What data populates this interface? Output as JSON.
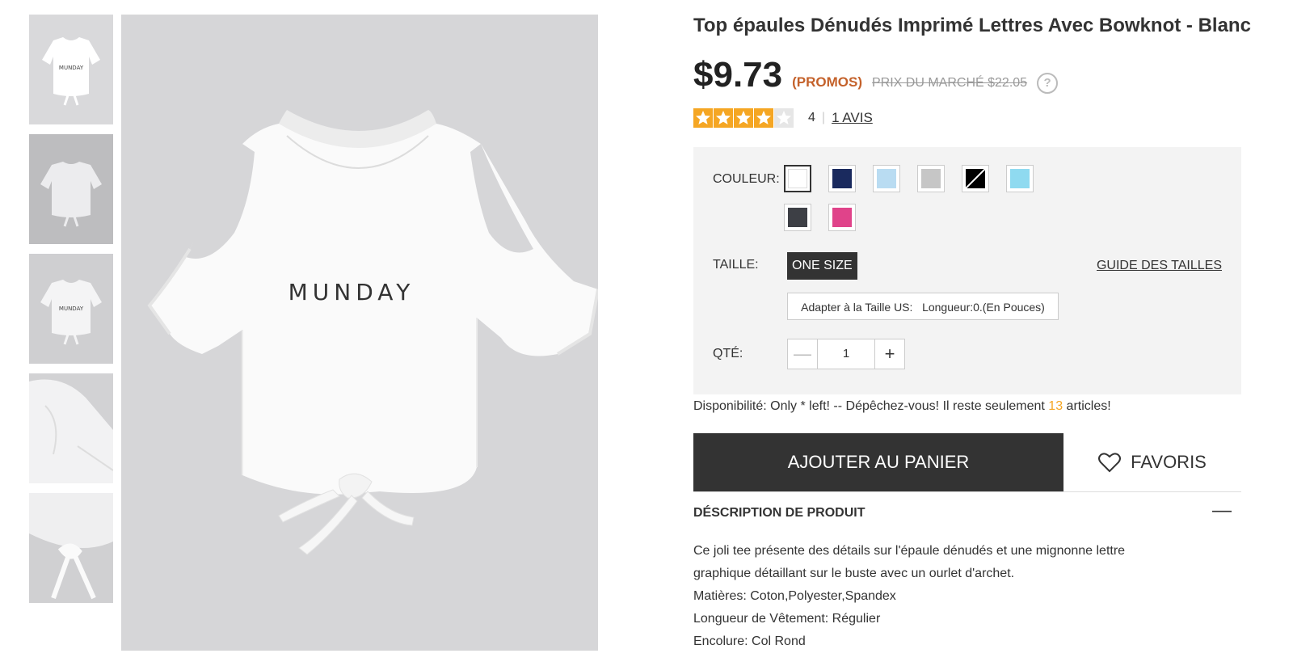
{
  "thumbnails": [
    {
      "name": "thumb-front",
      "alt": "front"
    },
    {
      "name": "thumb-back",
      "alt": "back"
    },
    {
      "name": "thumb-front-model",
      "alt": "front model"
    },
    {
      "name": "thumb-shoulder",
      "alt": "shoulder detail"
    },
    {
      "name": "thumb-bow",
      "alt": "bow detail"
    }
  ],
  "shirt_text": "MUNDAY",
  "product": {
    "title": "Top épaules Dénudés Imprimé Lettres Avec Bowknot - Blanc",
    "price": "$9.73",
    "promos": "(PROMOS)",
    "market_price": "PRIX DU MARCHÉ $22.05",
    "help_glyph": "?",
    "rating": 4,
    "rating_max": 5,
    "rating_text": "4",
    "separator": "|",
    "reviews_link": "1 AVIS"
  },
  "options": {
    "color_label": "COULEUR:",
    "colors": [
      {
        "name": "white",
        "hex": "#ffffff",
        "selected": true
      },
      {
        "name": "navy",
        "hex": "#1a2a5e"
      },
      {
        "name": "light-blue",
        "hex": "#b9dcf2"
      },
      {
        "name": "light-gray",
        "hex": "#c6c6c6"
      },
      {
        "name": "black-white",
        "hex": "#000000"
      },
      {
        "name": "sky-blue",
        "hex": "#8fdaf0"
      },
      {
        "name": "dark-gray",
        "hex": "#3d3f45"
      },
      {
        "name": "pink",
        "hex": "#e0438a"
      }
    ],
    "size_label": "TAILLE:",
    "size_value": "ONE SIZE",
    "size_guide": "GUIDE DES TAILLES",
    "fit_text": "Adapter à la Taille US:   Longueur:0.(En Pouces)",
    "qty_label": "QTÉ:",
    "qty_minus": "—",
    "qty_value": "1",
    "qty_plus": "+"
  },
  "availability": {
    "prefix": "Disponibilité: Only * left! -- Dépêchez-vous! Il reste seulement ",
    "count": "13",
    "suffix": " articles!"
  },
  "actions": {
    "add_to_cart": "AJOUTER AU PANIER",
    "favorites": "FAVORIS"
  },
  "description": {
    "heading": "DÉSCRIPTION DE PRODUIT",
    "collapse_glyph": "—",
    "lines": [
      "Ce joli tee présente des détails sur l'épaule dénudés et une mignonne lettre",
      "graphique détaillant sur le buste avec un ourlet d'archet.",
      "Matières: Coton,Polyester,Spandex",
      "Longueur de Vêtement: Régulier",
      "Encolure: Col Rond"
    ]
  },
  "colors": {
    "accent_orange": "#c4612a",
    "star": "#f5a623",
    "dark": "#333333"
  }
}
